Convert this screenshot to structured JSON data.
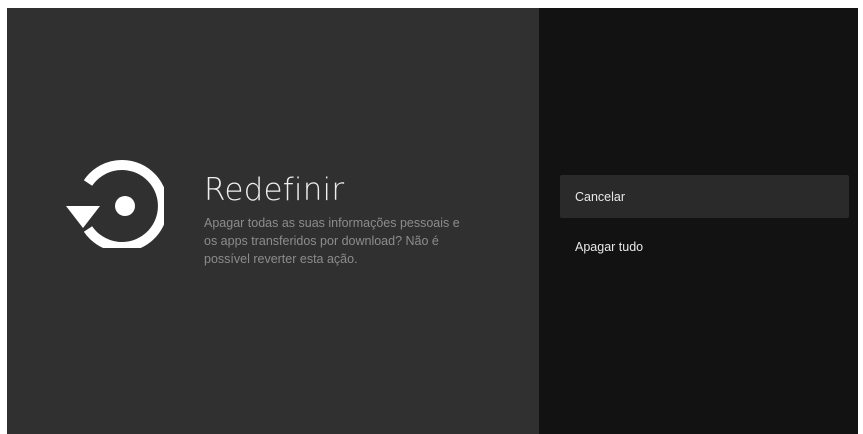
{
  "dialog": {
    "icon": "reset-icon",
    "title": "Redefinir",
    "description": "Apagar todas as suas informações pessoais e os apps transferidos por download? Não é possível reverter esta ação."
  },
  "actions": [
    {
      "label": "Cancelar",
      "focused": true
    },
    {
      "label": "Apagar tudo",
      "focused": false
    }
  ],
  "colors": {
    "left_panel_bg": "#303030",
    "right_panel_bg": "#121212",
    "focused_item_bg": "#2a2a2a",
    "title_text": "#eeeeee",
    "description_text": "#8c8c8c"
  }
}
